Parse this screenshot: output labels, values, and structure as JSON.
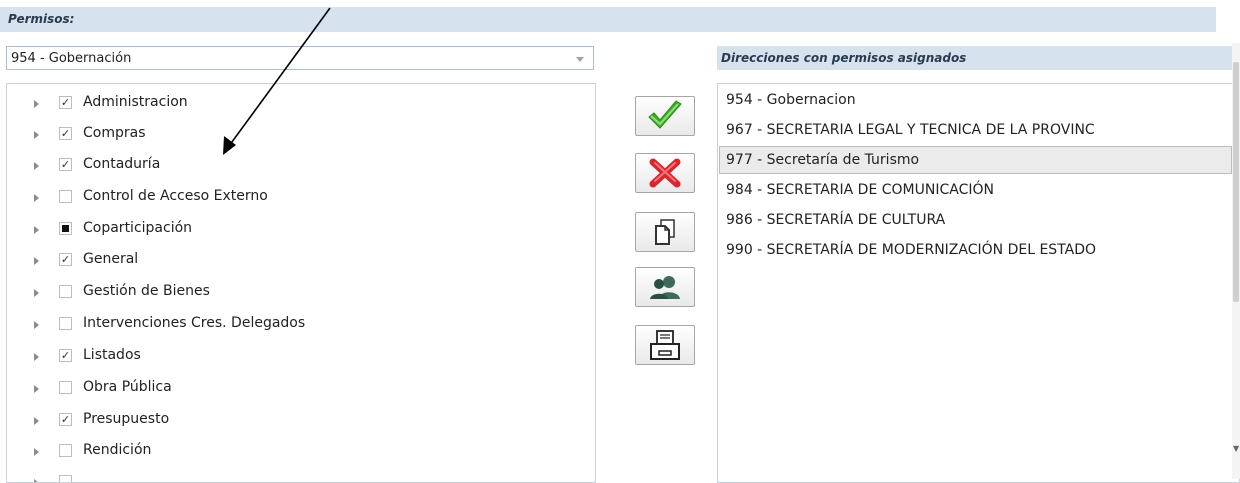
{
  "header": {
    "title": "Permisos:"
  },
  "select": {
    "value": "954 - Gobernación"
  },
  "tree": {
    "items": [
      {
        "label": "Administracion",
        "state": "checked"
      },
      {
        "label": "Compras",
        "state": "checked"
      },
      {
        "label": "Contaduría",
        "state": "checked"
      },
      {
        "label": "Control de Acceso Externo",
        "state": "unchecked"
      },
      {
        "label": "Coparticipación",
        "state": "partial"
      },
      {
        "label": "General",
        "state": "checked"
      },
      {
        "label": "Gestión de Bienes",
        "state": "unchecked"
      },
      {
        "label": "Intervenciones Cres. Delegados",
        "state": "unchecked"
      },
      {
        "label": "Listados",
        "state": "checked"
      },
      {
        "label": "Obra Pública",
        "state": "unchecked"
      },
      {
        "label": "Presupuesto",
        "state": "checked"
      },
      {
        "label": "Rendición",
        "state": "unchecked"
      }
    ]
  },
  "actions": [
    {
      "name": "confirm-button",
      "icon": "green-check-icon"
    },
    {
      "name": "delete-button",
      "icon": "red-x-icon"
    },
    {
      "name": "copy-button",
      "icon": "copy-document-icon"
    },
    {
      "name": "users-button",
      "icon": "user-group-icon"
    },
    {
      "name": "print-button",
      "icon": "printer-icon"
    }
  ],
  "directions": {
    "title": "Direcciones con permisos asignados",
    "items": [
      {
        "label": "954 - Gobernacion",
        "selected": false
      },
      {
        "label": "967 - SECRETARIA LEGAL Y TECNICA DE LA PROVINC",
        "selected": false
      },
      {
        "label": "977 - Secretaría de Turismo",
        "selected": true
      },
      {
        "label": "984 - SECRETARIA DE COMUNICACIÓN",
        "selected": false
      },
      {
        "label": "986 - SECRETARÍA DE CULTURA",
        "selected": false
      },
      {
        "label": "990 - SECRETARÍA DE MODERNIZACIÓN DEL ESTADO",
        "selected": false
      }
    ]
  },
  "colors": {
    "header_bg": "#d6e3ee",
    "check_green": "#3fae2a",
    "x_red": "#d9252b",
    "selected_row_bg": "#ebebeb"
  }
}
